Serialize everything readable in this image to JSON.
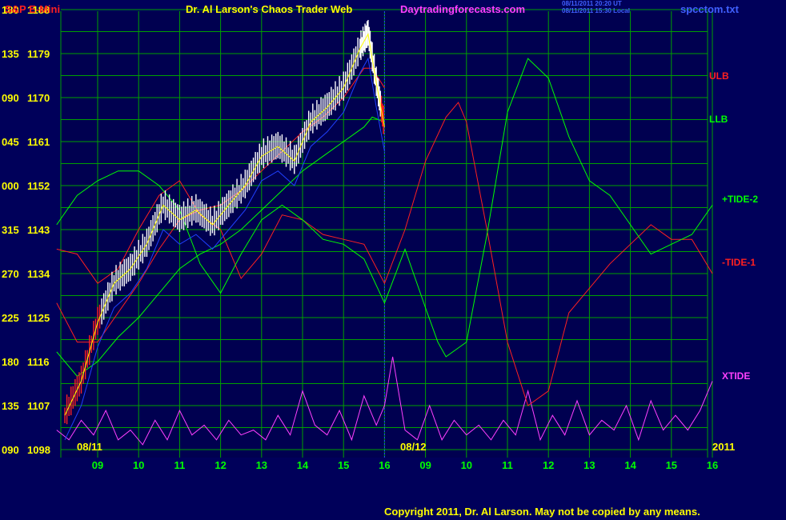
{
  "header": {
    "symbol": "S&P E-Mini",
    "title": "Dr. Al Larson's Chaos Trader Web",
    "site": "Daytradingforecasts.com",
    "timestamp_ut": "08/11/2011 20:20 UT",
    "timestamp_local": "08/11/2011 15:30 Local",
    "filename": "spcctom.txt"
  },
  "copyright": "Copyright 2011, Dr. Al Larson. May not be copied by any means.",
  "colors": {
    "background": "#00005a",
    "plot_background": "#000050",
    "grid": "#00a000",
    "axis_text": "#ffff00",
    "hour_labels": "#00ff00",
    "ulb": "#ff2020",
    "llb": "#00ff00",
    "tide_plus": "#00ff00",
    "tide_minus": "#ff2020",
    "xtide": "#ff40ff",
    "price_bars": "#ffffff",
    "symbol_text": "#ff2020",
    "site_text": "#ff40ff",
    "timestamp_text": "#4060ff",
    "filename_text": "#4060ff",
    "blue_line": "#2040ff"
  },
  "chart_data": {
    "type": "line",
    "title": "Dr. Al Larson's Chaos Trader Web",
    "y_price_ticks": [
      "1188",
      "1179",
      "1170",
      "1161",
      "1152",
      "1143",
      "1134",
      "1125",
      "1116",
      "1107",
      "1098"
    ],
    "y_angle_ticks": [
      "180",
      "135",
      "090",
      "045",
      "000",
      "315",
      "270",
      "225",
      "180",
      "135",
      "090"
    ],
    "ylim": [
      1098,
      1188
    ],
    "x_hour_ticks": [
      "09",
      "10",
      "11",
      "12",
      "13",
      "14",
      "15",
      "16",
      "09",
      "10",
      "11",
      "12",
      "13",
      "14",
      "15",
      "16"
    ],
    "date_labels": [
      "08/11",
      "08/12"
    ],
    "year_label": "2011",
    "series_labels": [
      "ULB",
      "LLB",
      "+TIDE-2",
      "-TIDE-1",
      "XTIDE"
    ],
    "price_segment": {
      "x_hours": [
        8.2,
        8.6,
        9.0,
        9.4,
        9.8,
        10.2,
        10.6,
        11.0,
        11.4,
        11.8,
        12.2,
        12.6,
        13.0,
        13.4,
        13.8,
        14.2,
        14.6,
        15.0,
        15.4,
        15.6,
        15.8,
        16.0
      ],
      "close": [
        1105,
        1112,
        1124,
        1132,
        1135,
        1140,
        1148,
        1145,
        1147,
        1144,
        1148,
        1152,
        1158,
        1160,
        1157,
        1165,
        1168,
        1172,
        1180,
        1183,
        1173,
        1164
      ]
    },
    "plus_tide_2": {
      "x_hours": [
        8.0,
        8.5,
        9.0,
        9.5,
        10.0,
        10.5,
        11.0,
        11.5,
        12.0,
        12.5,
        13.0,
        13.5,
        14.0,
        14.5,
        15.0,
        15.5,
        16.0,
        16.5,
        17.0,
        17.3,
        17.5,
        18.0,
        18.5,
        19.0,
        19.5,
        20.0,
        20.5,
        21.0,
        21.5,
        22.0,
        22.5,
        23.0,
        23.5,
        24.0
      ],
      "values": [
        1144,
        1150,
        1153,
        1155,
        1155,
        1152,
        1147,
        1136,
        1130,
        1138,
        1145,
        1148,
        1145,
        1141,
        1140,
        1137,
        1128,
        1139,
        1127,
        1120,
        1117,
        1120,
        1142,
        1167,
        1178,
        1174,
        1162,
        1153,
        1150,
        1144,
        1138,
        1140,
        1142,
        1148
      ]
    },
    "minus_tide_1": {
      "x_hours": [
        8.0,
        8.5,
        9.0,
        9.5,
        10.0,
        10.5,
        11.0,
        11.5,
        12.0,
        12.5,
        13.0,
        13.5,
        14.0,
        14.5,
        15.0,
        15.5,
        16.0,
        16.5,
        17.0,
        17.5,
        17.8,
        18.0,
        18.5,
        19.0,
        19.5,
        20.0,
        20.5,
        21.0,
        21.5,
        22.0,
        22.5,
        23.0,
        23.5,
        24.0
      ],
      "values": [
        1139,
        1138,
        1132,
        1135,
        1143,
        1150,
        1153,
        1146,
        1143,
        1133,
        1138,
        1146,
        1145,
        1142,
        1141,
        1140,
        1132,
        1143,
        1157,
        1166,
        1169,
        1165,
        1143,
        1120,
        1107,
        1110,
        1126,
        1131,
        1136,
        1140,
        1144,
        1141,
        1141,
        1134
      ]
    },
    "ulb": {
      "x_hours": [
        8.0,
        8.5,
        9.0,
        9.5,
        10.0,
        10.5,
        11.0,
        11.5,
        12.0,
        12.5,
        13.0,
        13.5,
        14.0,
        14.5,
        15.0,
        15.5,
        15.7,
        16.0
      ],
      "values": [
        1128,
        1120,
        1120,
        1126,
        1132,
        1139,
        1145,
        1147,
        1148,
        1151,
        1155,
        1159,
        1163,
        1166,
        1170,
        1176,
        1176,
        1172
      ]
    },
    "llb": {
      "x_hours": [
        8.0,
        8.5,
        9.0,
        9.5,
        10.0,
        10.5,
        11.0,
        11.5,
        12.0,
        12.5,
        13.0,
        13.5,
        14.0,
        14.5,
        15.0,
        15.5,
        15.7,
        16.0
      ],
      "values": [
        1118,
        1113,
        1116,
        1121,
        1125,
        1130,
        1135,
        1138,
        1140,
        1143,
        1147,
        1151,
        1155,
        1158,
        1161,
        1164,
        1166,
        1165
      ]
    },
    "xtide": {
      "x_hours": [
        8.0,
        8.3,
        8.6,
        8.9,
        9.2,
        9.5,
        9.8,
        10.1,
        10.4,
        10.7,
        11.0,
        11.3,
        11.6,
        11.9,
        12.2,
        12.5,
        12.8,
        13.1,
        13.4,
        13.7,
        14.0,
        14.3,
        14.6,
        14.9,
        15.2,
        15.5,
        15.8,
        16.0,
        16.2,
        16.5,
        16.8,
        17.1,
        17.4,
        17.7,
        18.0,
        18.3,
        18.6,
        18.9,
        19.2,
        19.5,
        19.8,
        20.1,
        20.4,
        20.7,
        21.0,
        21.3,
        21.6,
        21.9,
        22.2,
        22.5,
        22.8,
        23.1,
        23.4,
        23.7,
        24.0
      ],
      "values": [
        1102,
        1100,
        1104,
        1101,
        1106,
        1100,
        1102,
        1099,
        1104,
        1100,
        1106,
        1101,
        1103,
        1100,
        1104,
        1101,
        1102,
        1100,
        1105,
        1101,
        1110,
        1103,
        1101,
        1106,
        1100,
        1109,
        1103,
        1107,
        1117,
        1102,
        1100,
        1107,
        1100,
        1104,
        1101,
        1103,
        1100,
        1104,
        1101,
        1110,
        1100,
        1105,
        1101,
        1108,
        1101,
        1104,
        1102,
        1107,
        1100,
        1108,
        1102,
        1105,
        1102,
        1106,
        1112
      ]
    }
  }
}
